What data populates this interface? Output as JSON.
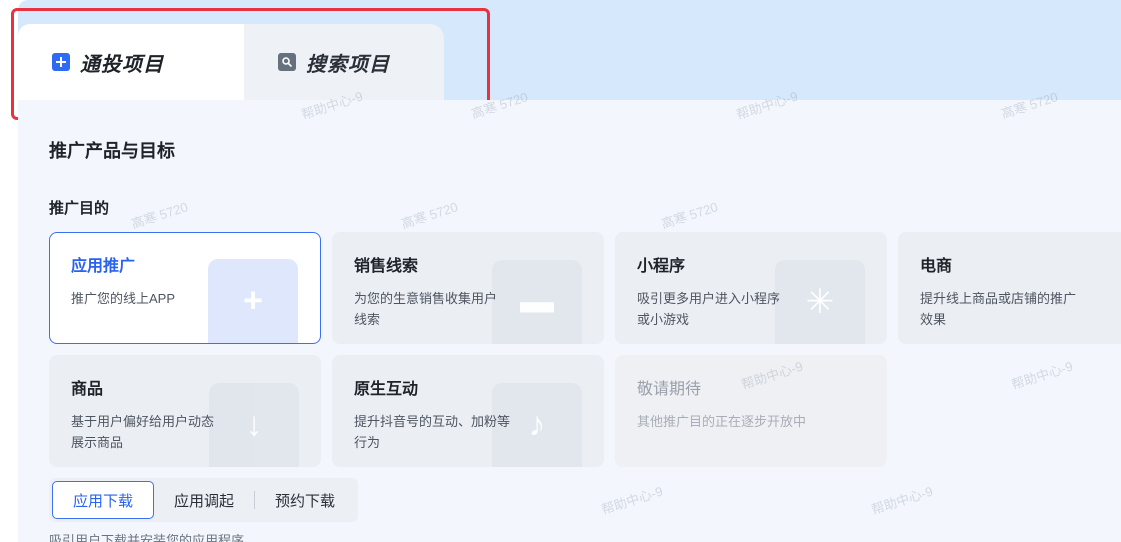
{
  "tabs": [
    {
      "label": "通投项目",
      "icon": "plus-square-icon",
      "active": true
    },
    {
      "label": "搜索项目",
      "icon": "search-square-icon",
      "active": false
    }
  ],
  "section_title": "推广产品与目标",
  "purpose_label": "推广目的",
  "cards": [
    {
      "title": "应用推广",
      "desc": "推广您的线上APP",
      "icon": "app-plus-icon",
      "selected": true
    },
    {
      "title": "销售线索",
      "desc": "为您的生意销售收集用户线索",
      "icon": "form-icon"
    },
    {
      "title": "小程序",
      "desc": "吸引更多用户进入小程序或小游戏",
      "icon": "mini-program-icon"
    },
    {
      "title": "电商",
      "desc": "提升线上商品或店铺的推广效果",
      "icon": "shop-icon"
    },
    {
      "title": "商品",
      "desc": "基于用户偏好给用户动态展示商品",
      "icon": "cart-icon"
    },
    {
      "title": "原生互动",
      "desc": "提升抖音号的互动、加粉等行为",
      "icon": "tiktok-icon"
    },
    {
      "title": "敬请期待",
      "desc": "其他推广目的正在逐步开放中",
      "disabled": true
    }
  ],
  "segments": [
    {
      "label": "应用下载",
      "active": true
    },
    {
      "label": "应用调起"
    },
    {
      "label": "预约下载"
    }
  ],
  "footer_text": "吸引用户下载并安装您的应用程序",
  "watermark": [
    "帮助中心-9",
    "高寒 5720"
  ],
  "colors": {
    "accent": "#2a62f0",
    "highlight": "#e8323f",
    "band": "#d6e8fb"
  }
}
